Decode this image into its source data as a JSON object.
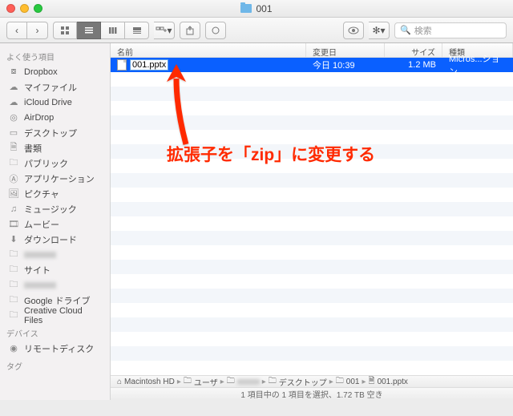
{
  "window": {
    "title": "001"
  },
  "search": {
    "placeholder": "検索"
  },
  "sidebar": {
    "sections": [
      {
        "label": "よく使う項目",
        "items": [
          {
            "icon": "dropbox",
            "label": "Dropbox"
          },
          {
            "icon": "cloud",
            "label": "マイファイル"
          },
          {
            "icon": "cloud",
            "label": "iCloud Drive"
          },
          {
            "icon": "airdrop",
            "label": "AirDrop"
          },
          {
            "icon": "desktop",
            "label": "デスクトップ"
          },
          {
            "icon": "doc",
            "label": "書類"
          },
          {
            "icon": "folder",
            "label": "パブリック"
          },
          {
            "icon": "app",
            "label": "アプリケーション"
          },
          {
            "icon": "pic",
            "label": "ピクチャ"
          },
          {
            "icon": "music",
            "label": "ミュージック"
          },
          {
            "icon": "movie",
            "label": "ムービー"
          },
          {
            "icon": "download",
            "label": "ダウンロード"
          },
          {
            "icon": "folder",
            "label": ""
          },
          {
            "icon": "folder",
            "label": "サイト"
          },
          {
            "icon": "folder",
            "label": ""
          },
          {
            "icon": "folder",
            "label": "Google ドライブ"
          },
          {
            "icon": "folder",
            "label": "Creative Cloud Files"
          }
        ]
      },
      {
        "label": "デバイス",
        "items": [
          {
            "icon": "disc",
            "label": "リモートディスク"
          }
        ]
      },
      {
        "label": "タグ",
        "items": []
      }
    ]
  },
  "columns": {
    "name": "名前",
    "date": "変更日",
    "size": "サイズ",
    "kind": "種類"
  },
  "files": [
    {
      "name": "001.pptx",
      "date": "今日 10:39",
      "size": "1.2 MB",
      "kind": "Micros...ション",
      "selected": true,
      "editing": true
    }
  ],
  "annotation": "拡張子を「zip」に変更する",
  "pathbar": [
    {
      "icon": "hd",
      "label": "Macintosh HD"
    },
    {
      "icon": "folder",
      "label": "ユーザ"
    },
    {
      "icon": "folder",
      "label": ""
    },
    {
      "icon": "folder",
      "label": "デスクトップ"
    },
    {
      "icon": "folder",
      "label": "001"
    },
    {
      "icon": "file",
      "label": "001.pptx"
    }
  ],
  "status": "1 項目中の 1 項目を選択、1.72 TB 空き"
}
